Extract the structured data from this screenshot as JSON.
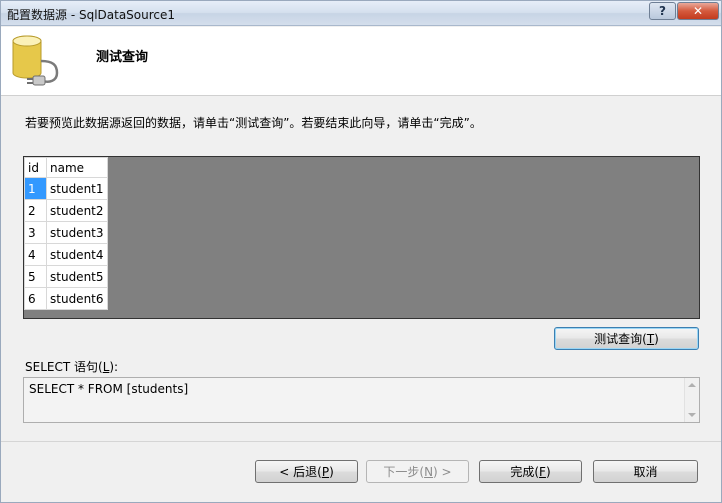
{
  "window": {
    "title": "配置数据源 - SqlDataSource1",
    "help_glyph": "?",
    "close_glyph": "✕"
  },
  "header": {
    "title": "测试查询",
    "icon": "database-icon"
  },
  "instruction": "若要预览此数据源返回的数据，请单击“测试查询”。若要结束此向导，请单击“完成”。",
  "grid": {
    "columns": [
      "id",
      "name"
    ],
    "rows": [
      {
        "id": "1",
        "name": "student1"
      },
      {
        "id": "2",
        "name": "student2"
      },
      {
        "id": "3",
        "name": "student3"
      },
      {
        "id": "4",
        "name": "student4"
      },
      {
        "id": "5",
        "name": "student5"
      },
      {
        "id": "6",
        "name": "student6"
      }
    ],
    "selected_row": 0
  },
  "test_query_button": {
    "pre": "测试查询(",
    "key": "T",
    "post": ")"
  },
  "select_label": {
    "pre": "SELECT 语句(",
    "key": "L",
    "post": "):"
  },
  "sql_text": "SELECT * FROM [students]",
  "buttons": {
    "back": {
      "pre": "< 后退(",
      "key": "P",
      "post": ")"
    },
    "next": {
      "pre": "下一步(",
      "key": "N",
      "post": ") >"
    },
    "finish": {
      "pre": "完成(",
      "key": "F",
      "post": ")"
    },
    "cancel": "取消"
  }
}
